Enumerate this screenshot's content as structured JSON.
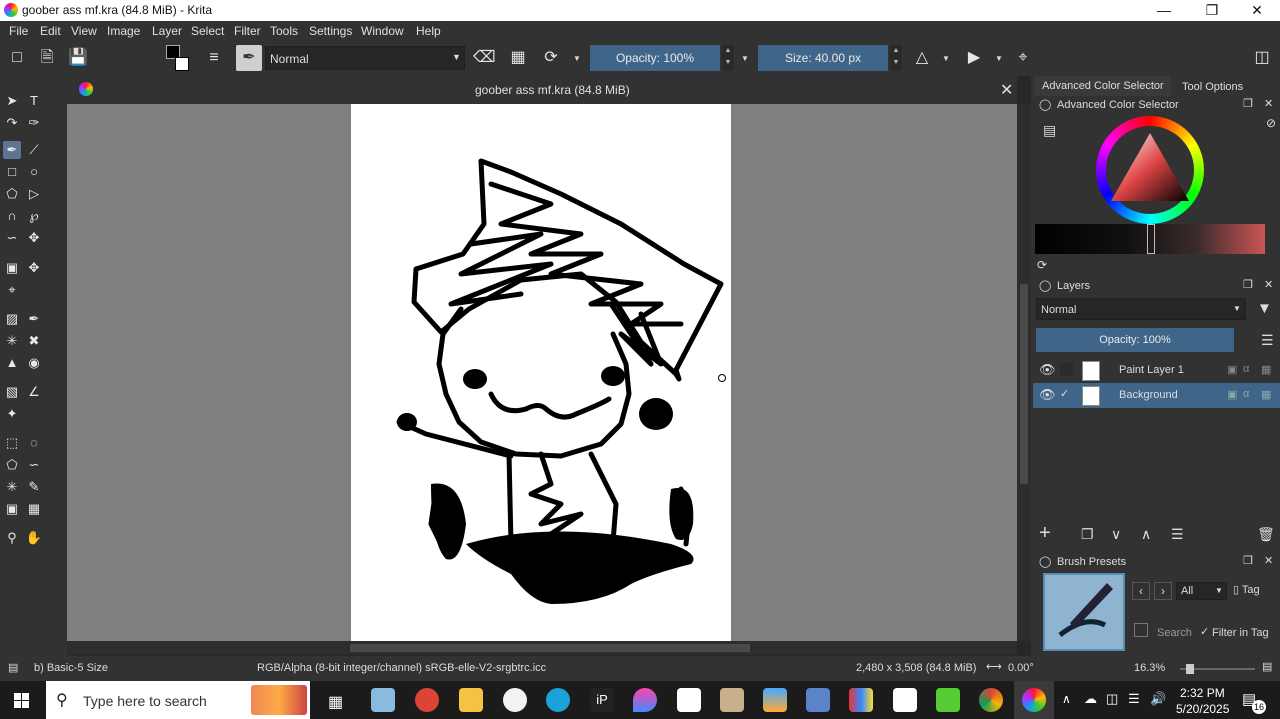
{
  "window": {
    "title": "goober ass mf.kra (84.8 MiB)  - Krita"
  },
  "menu": [
    "File",
    "Edit",
    "View",
    "Image",
    "Layer",
    "Select",
    "Filter",
    "Tools",
    "Settings",
    "Window",
    "Help"
  ],
  "toolbar": {
    "blend_mode": "Normal",
    "opacity_label": "Opacity: 100%",
    "size_label": "Size: 40.00 px"
  },
  "document": {
    "tab_title": "goober ass mf.kra (84.8 MiB)"
  },
  "dock": {
    "tabs": [
      "Advanced Color Selector",
      "Tool Options"
    ],
    "color_selector_title": "Advanced Color Selector",
    "layers_title": "Layers",
    "layers_blend": "Normal",
    "layers_opacity": "Opacity:  100%",
    "layers": [
      {
        "name": "Paint Layer 1",
        "selected": false
      },
      {
        "name": "Background",
        "selected": true
      }
    ],
    "brush_presets_title": "Brush Presets",
    "tag_filter": "All",
    "tag_label": "Tag",
    "search_placeholder": "Search",
    "filter_in_tag": "Filter in Tag"
  },
  "status": {
    "brush": "b) Basic-5 Size",
    "color_space": "RGB/Alpha (8-bit integer/channel)  sRGB-elle-V2-srgbtrc.icc",
    "dimensions": "2,480 x 3,508 (84.8 MiB)",
    "rotation": "0.00°",
    "zoom": "16.3%"
  },
  "taskbar": {
    "search_placeholder": "Type here to search",
    "time": "2:32 PM",
    "date": "5/20/2025",
    "notifications": "16"
  },
  "colors": {
    "accent": "#3f6689",
    "fg": "#000000",
    "bg": "#ffffff"
  }
}
